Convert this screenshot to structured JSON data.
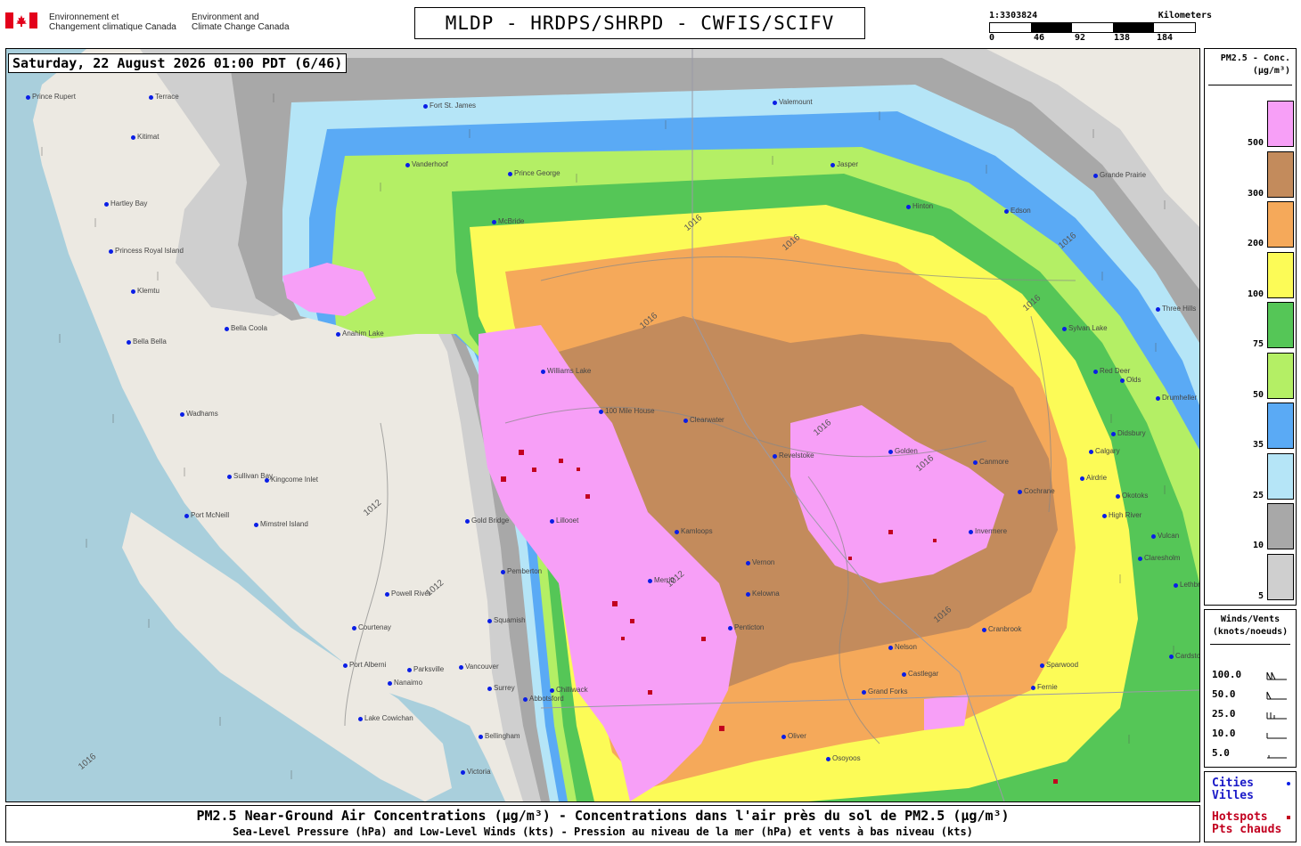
{
  "header": {
    "dept_fr": [
      "Environnement et",
      "Changement climatique Canada"
    ],
    "dept_en": [
      "Environment and",
      "Climate Change Canada"
    ],
    "title": "MLDP - HRDPS/SHRPD - CWFIS/SCIFV",
    "scale": {
      "ratio": "1:3303824",
      "units": "Kilometers",
      "ticks": [
        "0",
        "46",
        "92",
        "138",
        "184"
      ]
    }
  },
  "map": {
    "timestamp": "Saturday, 22 August 2026 01:00 PDT (6/46)",
    "colors": {
      "ocean": "#a9cfdc",
      "land": "#ece9e2",
      "gray_light": "#cfcfcf",
      "gray_dark": "#a8a8a8",
      "blue_light": "#b5e5f7",
      "blue": "#5aaaf5",
      "green_light": "#b4ef65",
      "green": "#55c657",
      "yellow": "#fcfb57",
      "orange": "#f5a95a",
      "brown": "#c38b5c",
      "pink": "#f79ff7",
      "hotspot": "#c2001f",
      "city_dot": "#0a1ee6"
    },
    "isobar_labels": [
      "1016",
      "1016",
      "1016",
      "1016",
      "1012",
      "1012",
      "1016",
      "1016",
      "1016",
      "1012",
      "1016",
      "1016"
    ],
    "cities": [
      "Prince Rupert",
      "Terrace",
      "Kitimat",
      "Hartley Bay",
      "Princess Royal Island",
      "Klemtu",
      "Bella Bella",
      "Bella Coola",
      "Anahim Lake",
      "Williams Lake",
      "100 Mile House",
      "Wadhams",
      "Port McNeill",
      "Kingcome Inlet",
      "Sullivan Bay",
      "Mimstrel Island",
      "Powell River",
      "Courtenay",
      "Port Alberni",
      "Parksville",
      "Nanaimo",
      "Lake Cowichan",
      "Victoria",
      "Vancouver",
      "Surrey",
      "Abbotsford",
      "Bellingham",
      "Chilliwack",
      "Squamish",
      "Pemberton",
      "Gold Bridge",
      "Lillooet",
      "Kamloops",
      "Clearwater",
      "Merritt",
      "Vernon",
      "Kelowna",
      "Penticton",
      "Revelstoke",
      "Golden",
      "Canmore",
      "Calgary",
      "Invermere",
      "Nelson",
      "Cranbrook",
      "Fort St. James",
      "Vanderhoof",
      "Prince George",
      "McBride",
      "Valemount",
      "Jasper",
      "Hinton",
      "Edson",
      "Grande Prairie",
      "Sylvan Lake",
      "Red Deer",
      "Drumheller",
      "Lethbridge",
      "Cardston",
      "Oliver",
      "Osoyoos",
      "Grand Forks",
      "Castlegar",
      "Fernie",
      "Sparwood",
      "High River",
      "Vulcan",
      "Claresholm",
      "Okotoks",
      "Cochrane",
      "Airdrie",
      "Olds",
      "Three Hills",
      "Didsbury"
    ]
  },
  "legend": {
    "title": [
      "PM2.5 - Conc.",
      "(µg/m³)"
    ],
    "items": [
      {
        "label": "500",
        "color": "#f79ff7"
      },
      {
        "label": "300",
        "color": "#c38b5c"
      },
      {
        "label": "200",
        "color": "#f5a95a"
      },
      {
        "label": "100",
        "color": "#fcfb57"
      },
      {
        "label": "75",
        "color": "#55c657"
      },
      {
        "label": "50",
        "color": "#b4ef65"
      },
      {
        "label": "35",
        "color": "#5aaaf5"
      },
      {
        "label": "25",
        "color": "#b5e5f7"
      },
      {
        "label": "10",
        "color": "#a8a8a8"
      },
      {
        "label": "5",
        "color": "#cfcfcf"
      }
    ]
  },
  "winds": {
    "title": [
      "Winds/Vents",
      "(knots/noeuds)"
    ],
    "values": [
      "100.0",
      "50.0",
      "25.0",
      "10.0",
      "5.0"
    ]
  },
  "keys": {
    "cities": [
      "Cities",
      "Villes"
    ],
    "hotspots": [
      "Hotspots",
      "Pts chauds"
    ]
  },
  "footer": {
    "line1": "PM2.5 Near-Ground Air Concentrations (µg/m³) - Concentrations dans l'air près du sol de PM2.5 (µg/m³)",
    "line2": "Sea-Level Pressure (hPa) and Low-Level Winds (kts) - Pression au niveau de la mer (hPa) et vents à bas niveau (kts)"
  }
}
